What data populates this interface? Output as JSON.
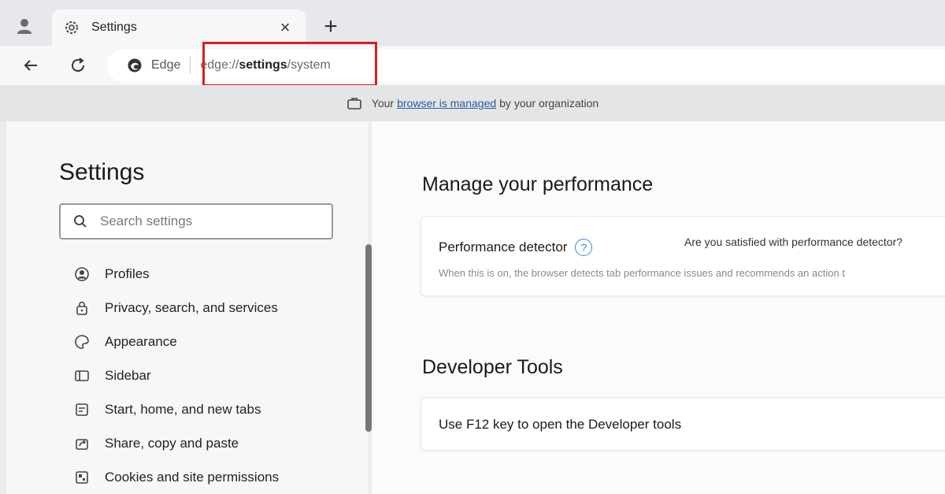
{
  "tab": {
    "title": "Settings",
    "close": "×"
  },
  "newtab": "+",
  "address": {
    "edge_label": "Edge",
    "url_prefix": "edge://",
    "url_bold": "settings",
    "url_suffix": "/system"
  },
  "banner": {
    "before": "Your",
    "link": "browser is managed",
    "after": "by your organization"
  },
  "sidebar": {
    "title": "Settings",
    "search_placeholder": "Search settings",
    "items": [
      {
        "label": "Profiles",
        "icon": "profile-icon"
      },
      {
        "label": "Privacy, search, and services",
        "icon": "lock-icon"
      },
      {
        "label": "Appearance",
        "icon": "appearance-icon"
      },
      {
        "label": "Sidebar",
        "icon": "sidebar-icon"
      },
      {
        "label": "Start, home, and new tabs",
        "icon": "home-icon"
      },
      {
        "label": "Share, copy and paste",
        "icon": "share-icon"
      },
      {
        "label": "Cookies and site permissions",
        "icon": "cookie-icon"
      }
    ]
  },
  "main": {
    "perf_section_title": "Manage your performance",
    "perf_label": "Performance detector",
    "perf_help": "?",
    "perf_feedback": "Are you satisfied with performance detector?",
    "perf_desc": "When this is on, the browser detects tab performance issues and recommends an action t",
    "dev_section_title": "Developer Tools",
    "dev_label": "Use F12 key to open the Developer tools"
  },
  "colors": {
    "highlight": "#d91e26",
    "link": "#2c5aa0",
    "help": "#3a86d9"
  }
}
